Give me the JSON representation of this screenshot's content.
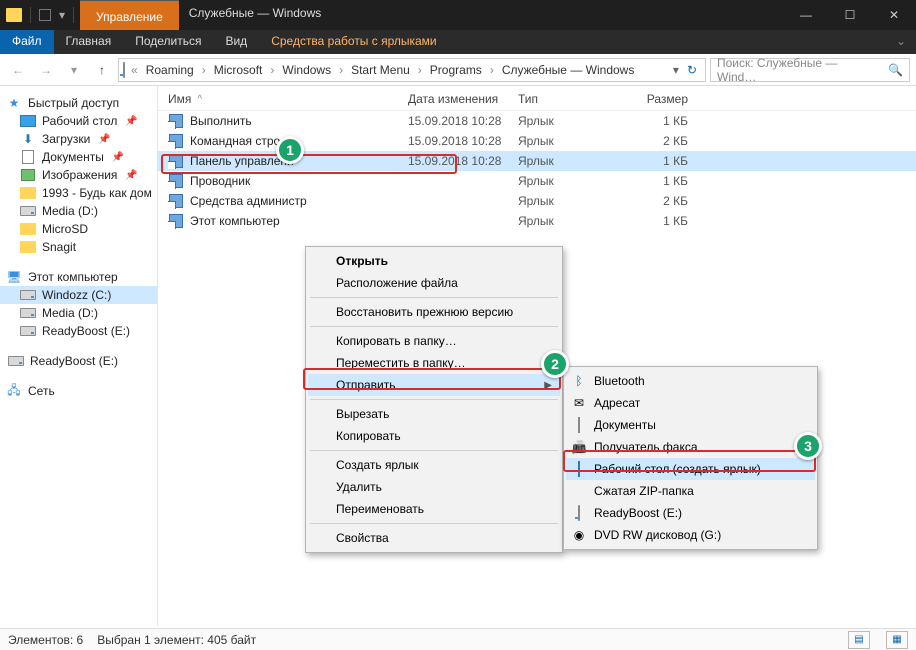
{
  "window": {
    "ribbon_tab": "Управление",
    "title": "Служебные — Windows"
  },
  "menu": {
    "file": "Файл",
    "home": "Главная",
    "share": "Поделиться",
    "view": "Вид",
    "shortcut_tools": "Средства работы с ярлыками"
  },
  "breadcrumbs": [
    "Roaming",
    "Microsoft",
    "Windows",
    "Start Menu",
    "Programs",
    "Служебные — Windows"
  ],
  "search_placeholder": "Поиск: Служебные — Wind…",
  "nav": {
    "quick_access": "Быстрый доступ",
    "items_qa": [
      {
        "label": "Рабочий стол",
        "pinned": true,
        "icon": "desktop"
      },
      {
        "label": "Загрузки",
        "pinned": true,
        "icon": "download"
      },
      {
        "label": "Документы",
        "pinned": true,
        "icon": "doc"
      },
      {
        "label": "Изображения",
        "pinned": true,
        "icon": "img"
      },
      {
        "label": "1993 - Будь как дом",
        "pinned": false,
        "icon": "folder"
      },
      {
        "label": "Media (D:)",
        "pinned": false,
        "icon": "drive"
      },
      {
        "label": "MicroSD",
        "pinned": false,
        "icon": "folder"
      },
      {
        "label": "Snagit",
        "pinned": false,
        "icon": "folder"
      }
    ],
    "this_pc": "Этот компьютер",
    "items_pc": [
      {
        "label": "Windozz (C:)",
        "icon": "drive",
        "selected": true
      },
      {
        "label": "Media (D:)",
        "icon": "drive"
      },
      {
        "label": "ReadyBoost (E:)",
        "icon": "drive"
      }
    ],
    "items_after": [
      {
        "label": "ReadyBoost (E:)",
        "icon": "drive"
      }
    ],
    "network": "Сеть"
  },
  "columns": {
    "name": "Имя",
    "date": "Дата изменения",
    "type": "Тип",
    "size": "Размер"
  },
  "files": [
    {
      "name": "Выполнить",
      "date": "15.09.2018 10:28",
      "type": "Ярлык",
      "size": "1 КБ"
    },
    {
      "name": "Командная стро",
      "date": "15.09.2018 10:28",
      "type": "Ярлык",
      "size": "2 КБ"
    },
    {
      "name": "Панель управлени",
      "date": "15.09.2018 10:28",
      "type": "Ярлык",
      "size": "1 КБ",
      "selected": true
    },
    {
      "name": "Проводник",
      "date": "",
      "type": "Ярлык",
      "size": "1 КБ"
    },
    {
      "name": "Средства администр",
      "date": "",
      "type": "Ярлык",
      "size": "2 КБ"
    },
    {
      "name": "Этот компьютер",
      "date": "",
      "type": "Ярлык",
      "size": "1 КБ"
    }
  ],
  "context_menu": [
    {
      "label": "Открыть",
      "bold": true
    },
    {
      "label": "Расположение файла"
    },
    {
      "sep": true
    },
    {
      "label": "Восстановить прежнюю версию"
    },
    {
      "sep": true
    },
    {
      "label": "Копировать в папку…"
    },
    {
      "label": "Переместить в папку…"
    },
    {
      "label": "Отправить",
      "submenu": true,
      "hl": true
    },
    {
      "sep": true
    },
    {
      "label": "Вырезать"
    },
    {
      "label": "Копировать"
    },
    {
      "sep": true
    },
    {
      "label": "Создать ярлык"
    },
    {
      "label": "Удалить"
    },
    {
      "label": "Переименовать"
    },
    {
      "sep": true
    },
    {
      "label": "Свойства"
    }
  ],
  "sendto_menu": [
    {
      "label": "Bluetooth",
      "icon": "bt"
    },
    {
      "label": "Адресат",
      "icon": "mail"
    },
    {
      "label": "Документы",
      "icon": "doc"
    },
    {
      "label": "Получатель факса",
      "icon": "fax"
    },
    {
      "label": "Рабочий стол (создать ярлык)",
      "icon": "desktop",
      "hl": true
    },
    {
      "label": "Сжатая ZIP-папка",
      "icon": "zip"
    },
    {
      "label": "ReadyBoost (E:)",
      "icon": "drive"
    },
    {
      "label": "DVD RW дисковод (G:)",
      "icon": "dvd"
    }
  ],
  "badges": {
    "b1": "1",
    "b2": "2",
    "b3": "3"
  },
  "status": {
    "count": "Элементов: 6",
    "selected": "Выбран 1 элемент: 405 байт"
  },
  "colors": {
    "accent": "#0a64ad",
    "badge": "#1aa36b",
    "highlight_red": "#d82c2c",
    "selection": "#cde8ff"
  }
}
